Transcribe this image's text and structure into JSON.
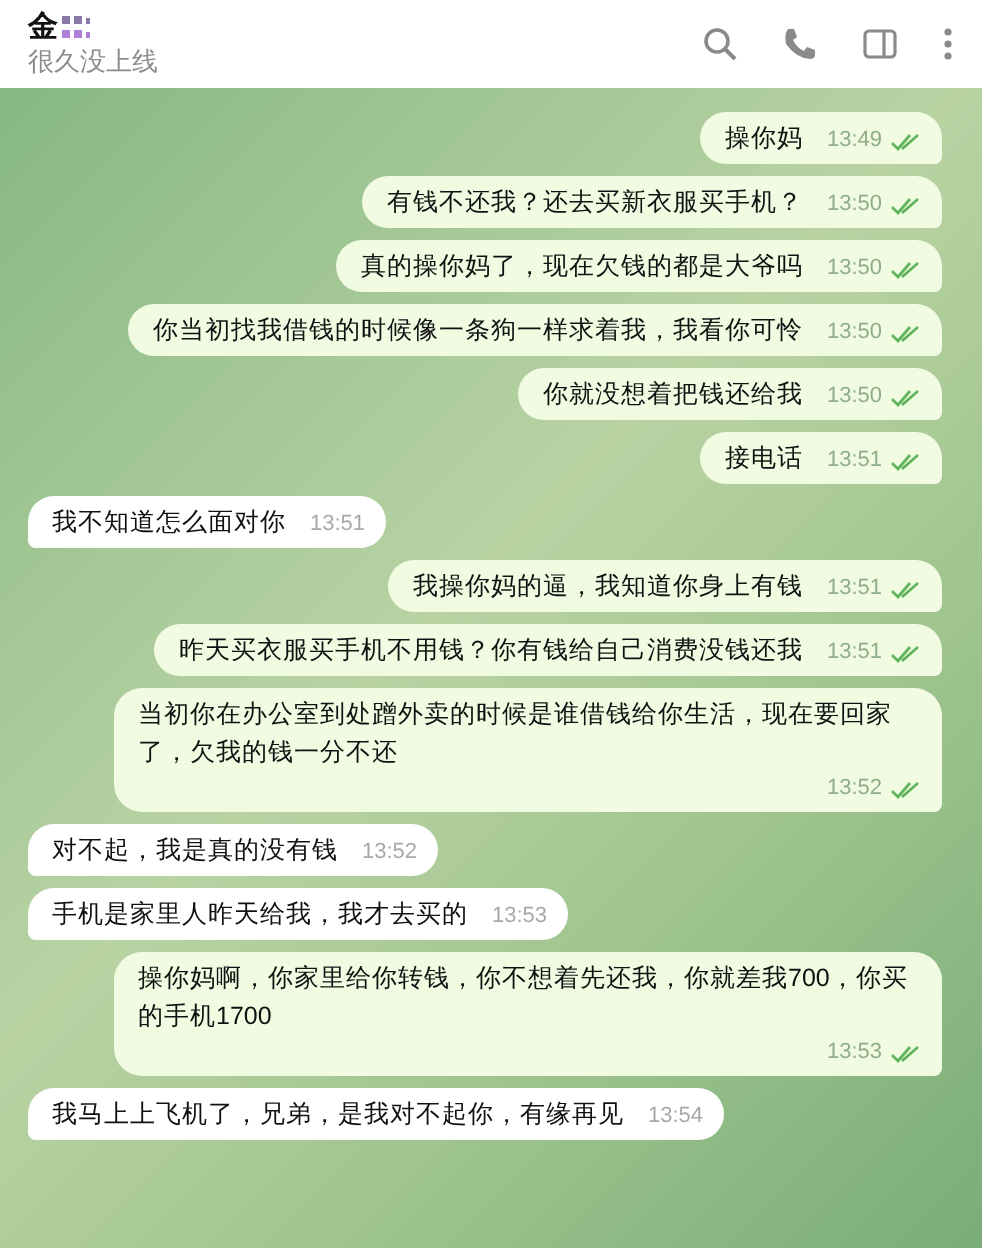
{
  "header": {
    "name": "金",
    "status": "很久没上线"
  },
  "messages": [
    {
      "kind": "out",
      "text": "操你妈",
      "time": "13:49",
      "read": true
    },
    {
      "kind": "out",
      "text": "有钱不还我？还去买新衣服买手机？",
      "time": "13:50",
      "read": true
    },
    {
      "kind": "out",
      "text": "真的操你妈了，现在欠钱的都是大爷吗",
      "time": "13:50",
      "read": true
    },
    {
      "kind": "out",
      "text": "你当初找我借钱的时候像一条狗一样求着我，我看你可怜",
      "time": "13:50",
      "read": true
    },
    {
      "kind": "out",
      "text": "你就没想着把钱还给我",
      "time": "13:50",
      "read": true
    },
    {
      "kind": "out",
      "text": "接电话",
      "time": "13:51",
      "read": true
    },
    {
      "kind": "in",
      "text": "我不知道怎么面对你",
      "time": "13:51"
    },
    {
      "kind": "out",
      "text": "我操你妈的逼，我知道你身上有钱",
      "time": "13:51",
      "read": true
    },
    {
      "kind": "out",
      "text": "昨天买衣服买手机不用钱？你有钱给自己消费没钱还我",
      "time": "13:51",
      "read": true
    },
    {
      "kind": "out",
      "text": "当初你在办公室到处蹭外卖的时候是谁借钱给你生活，现在要回家了，欠我的钱一分不还",
      "time": "13:52",
      "read": true
    },
    {
      "kind": "in",
      "text": "对不起，我是真的没有钱",
      "time": "13:52"
    },
    {
      "kind": "in",
      "text": "手机是家里人昨天给我，我才去买的",
      "time": "13:53"
    },
    {
      "kind": "out",
      "text": "操你妈啊，你家里给你转钱，你不想着先还我，你就差我700，你买的手机1700",
      "time": "13:53",
      "read": true
    },
    {
      "kind": "in",
      "text": "我马上上飞机了，兄弟，是我对不起你，有缘再见",
      "time": "13:54"
    }
  ]
}
